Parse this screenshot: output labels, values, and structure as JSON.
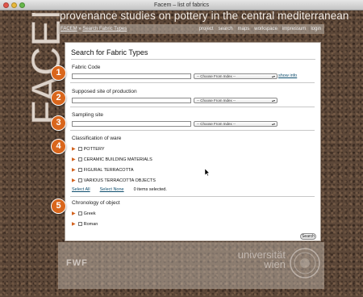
{
  "window": {
    "title": "Facem – list of fabrics"
  },
  "brand": {
    "logo_text": "FACEM",
    "site_title": "provenance studies on pottery in the central mediterranean"
  },
  "breadcrumb": {
    "home": "FACEM",
    "separator": " » ",
    "current": "Search Fabric Types"
  },
  "nav": [
    "project",
    "search",
    "maps",
    "workspace",
    "impressum",
    "login"
  ],
  "page": {
    "heading": "Search for Fabric Types"
  },
  "fabric_code": {
    "label": "Fabric Code",
    "select_value": "-- Choose From Index --",
    "show_info": "show info"
  },
  "production_site": {
    "label": "Supposed site of production",
    "select_value": "-- Choose From Index --"
  },
  "sampling_site": {
    "label": "Sampling site",
    "select_value": "-- Choose From Index --"
  },
  "ware": {
    "label": "Classification of ware",
    "items": [
      "POTTERY",
      "CERAMIC BUILDING MATERIALS",
      "FIGURAL TERRACOTTA",
      "VARIOUS TERRACOTTA OBJECTS"
    ],
    "select_all": "Select All",
    "select_none": "Select None",
    "count_text": "0 items selected."
  },
  "chronology": {
    "label": "Chronology of object",
    "items": [
      "Greek",
      "Roman"
    ]
  },
  "search_button": "Search",
  "badges": [
    "1",
    "2",
    "3",
    "4",
    "5"
  ],
  "footer": {
    "fwf": "FWF",
    "university_line1": "universität",
    "university_line2": "wien"
  },
  "colors": {
    "badge": "#d9661c",
    "link": "#0e4d6d",
    "background": "#5c4738"
  }
}
